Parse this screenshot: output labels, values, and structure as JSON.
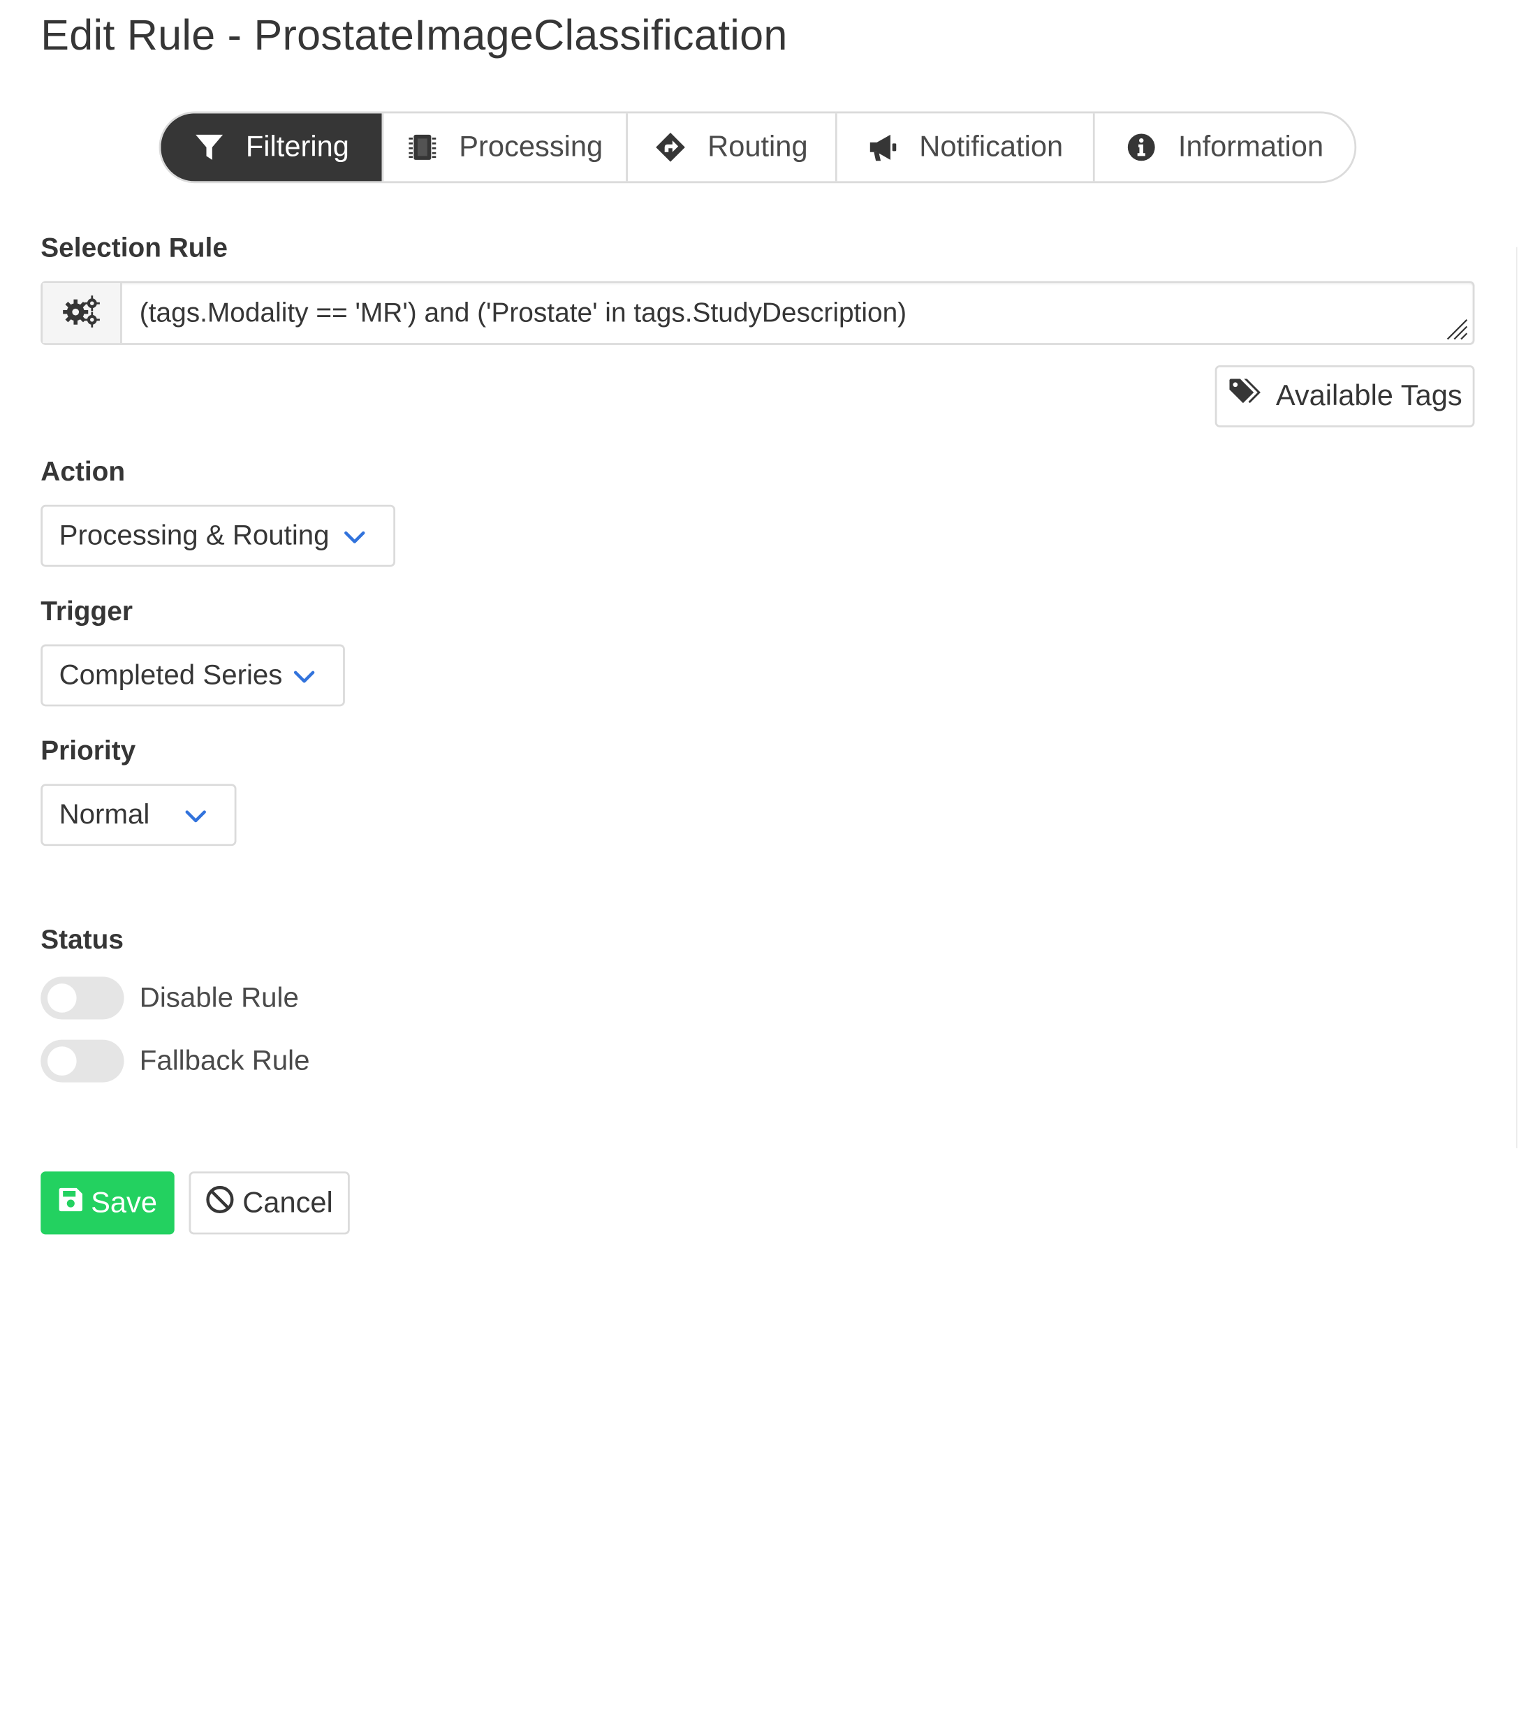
{
  "page": {
    "title": "Edit Rule - ProstateImageClassification"
  },
  "tabs": [
    {
      "label": "Filtering",
      "icon": "filter-icon",
      "active": true
    },
    {
      "label": "Processing",
      "icon": "chip-icon",
      "active": false
    },
    {
      "label": "Routing",
      "icon": "route-arrow-icon",
      "active": false
    },
    {
      "label": "Notification",
      "icon": "megaphone-icon",
      "active": false
    },
    {
      "label": "Information",
      "icon": "info-icon",
      "active": false
    }
  ],
  "selection": {
    "label": "Selection Rule",
    "value": "(tags.Modality == 'MR') and ('Prostate' in tags.StudyDescription)",
    "addon_icon": "gears-icon",
    "tags_button": "Available Tags",
    "tags_icon": "tags-icon"
  },
  "action": {
    "label": "Action",
    "value": "Processing & Routing"
  },
  "trigger": {
    "label": "Trigger",
    "value": "Completed Series"
  },
  "priority": {
    "label": "Priority",
    "value": "Normal"
  },
  "status": {
    "label": "Status",
    "disable_rule": {
      "label": "Disable Rule",
      "on": false
    },
    "fallback_rule": {
      "label": "Fallback Rule",
      "on": false
    }
  },
  "buttons": {
    "save": "Save",
    "cancel": "Cancel"
  },
  "colors": {
    "active_tab_bg": "#363636",
    "save_green": "#23d160",
    "chevron_blue": "#3273dc",
    "border": "#dbdbdb"
  }
}
